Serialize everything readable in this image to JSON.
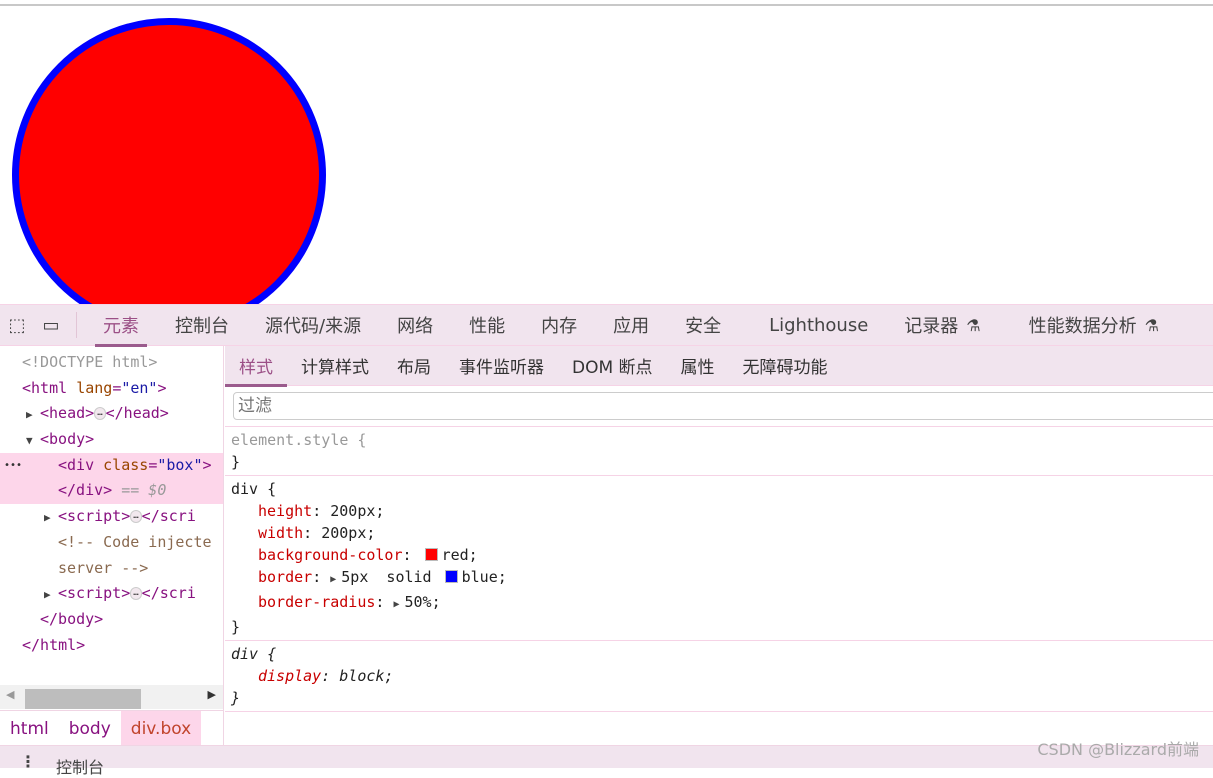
{
  "page": {
    "circle": {
      "fill": "#ff0000",
      "border": "#0000ff"
    }
  },
  "devtools": {
    "main_tabs": [
      {
        "label": "元素",
        "active": true
      },
      {
        "label": "控制台"
      },
      {
        "label": "源代码/来源"
      },
      {
        "label": "网络"
      },
      {
        "label": "性能"
      },
      {
        "label": "内存"
      },
      {
        "label": "应用"
      },
      {
        "label": "安全"
      },
      {
        "label": "Lighthouse"
      },
      {
        "label": "记录器",
        "flask": true
      },
      {
        "label": "性能数据分析",
        "flask": true
      }
    ],
    "accent": "#9b4f86",
    "dom": {
      "doctype": "<!DOCTYPE html>",
      "html_open": "<html",
      "lang_attr": "lang",
      "lang_val": "\"en\"",
      "gt": ">",
      "head": "<head>",
      "head_close": "</head>",
      "ellipsis": "…",
      "body": "<body>",
      "div_open": "<div",
      "class_attr": "class",
      "class_val": "\"box\"",
      "div_close": "</div>",
      "selected_marker": "== $0",
      "row_dots": "•••",
      "script": "<script>",
      "script_close": "</scri",
      "comment1": "<!-- Code injecte",
      "comment2": "server -->",
      "body_close": "</body>",
      "html_close": "</html>"
    },
    "breadcrumbs": [
      {
        "label": "html"
      },
      {
        "label": "body"
      },
      {
        "label": "div.box",
        "selected": true
      }
    ],
    "sub_tabs": [
      {
        "label": "样式",
        "active": true
      },
      {
        "label": "计算样式"
      },
      {
        "label": "布局"
      },
      {
        "label": "事件监听器"
      },
      {
        "label": "DOM 断点"
      },
      {
        "label": "属性"
      },
      {
        "label": "无障碍功能"
      }
    ],
    "filter_placeholder": "过滤",
    "styles": {
      "element_style": "element.style {",
      "close": "}",
      "rule1_selector": "div {",
      "rule1_props": [
        {
          "name": "height",
          "value": "200px;"
        },
        {
          "name": "width",
          "value": "200px;"
        },
        {
          "name": "background-color",
          "value": "red;",
          "swatch": "#ff0000"
        },
        {
          "name": "border",
          "value": "5px  solid",
          "swatch": "#0000ff",
          "value2": "blue;",
          "expandable": true
        },
        {
          "name": "border-radius",
          "value": "50%;",
          "expandable": true
        }
      ],
      "rule2_selector": "div {",
      "rule2_props": [
        {
          "name": "display",
          "value": "block;"
        }
      ]
    },
    "drawer": {
      "label": "控制台"
    },
    "watermark": "CSDN @Blizzard前端"
  }
}
